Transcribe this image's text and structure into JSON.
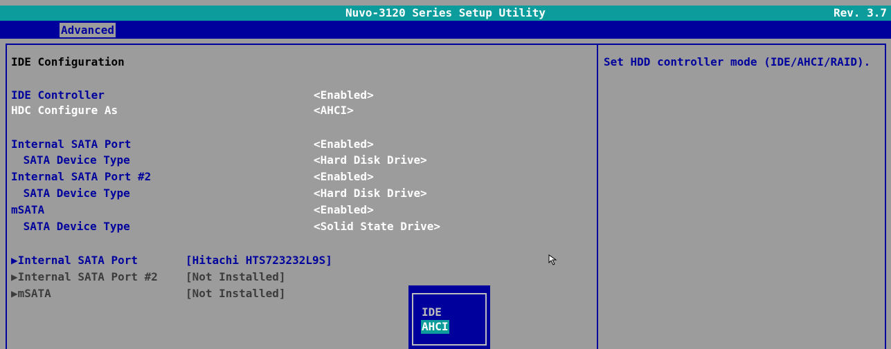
{
  "header": {
    "title": "Nuvo-3120 Series Setup Utility",
    "revision": "Rev. 3.7"
  },
  "menu": {
    "tabs": [
      {
        "label": "Advanced",
        "active": true
      }
    ]
  },
  "main": {
    "section_title": "IDE Configuration",
    "settings": [
      {
        "label": "IDE Controller",
        "value": "<Enabled>"
      },
      {
        "label": "HDC Configure As",
        "value": "<AHCI>",
        "selected": true
      },
      {
        "label": "Internal SATA Port",
        "value": "<Enabled>"
      },
      {
        "label": " SATA Device Type",
        "value": "<Hard Disk Drive>"
      },
      {
        "label": "Internal SATA Port #2",
        "value": "<Enabled>"
      },
      {
        "label": " SATA Device Type",
        "value": "<Hard Disk Drive>"
      },
      {
        "label": "mSATA",
        "value": "<Enabled>"
      },
      {
        "label": " SATA Device Type",
        "value": "<Solid State Drive>"
      }
    ],
    "submenus": [
      {
        "label": "▶Internal SATA Port",
        "device": "[Hitachi HTS723232L9S]"
      },
      {
        "label": "▶Internal SATA Port #2",
        "device": "[Not Installed]"
      },
      {
        "label": "▶mSATA",
        "device": "[Not Installed]"
      }
    ]
  },
  "help": {
    "text": "Set HDD controller mode (IDE/AHCI/RAID)."
  },
  "popup": {
    "options": [
      "IDE",
      "AHCI"
    ],
    "selected": "AHCI"
  },
  "colors": {
    "title_bar": "#0c9c9c",
    "menu_bar": "#00009c",
    "panel": "#9c9c9c",
    "highlight": "#0c9c9c"
  }
}
